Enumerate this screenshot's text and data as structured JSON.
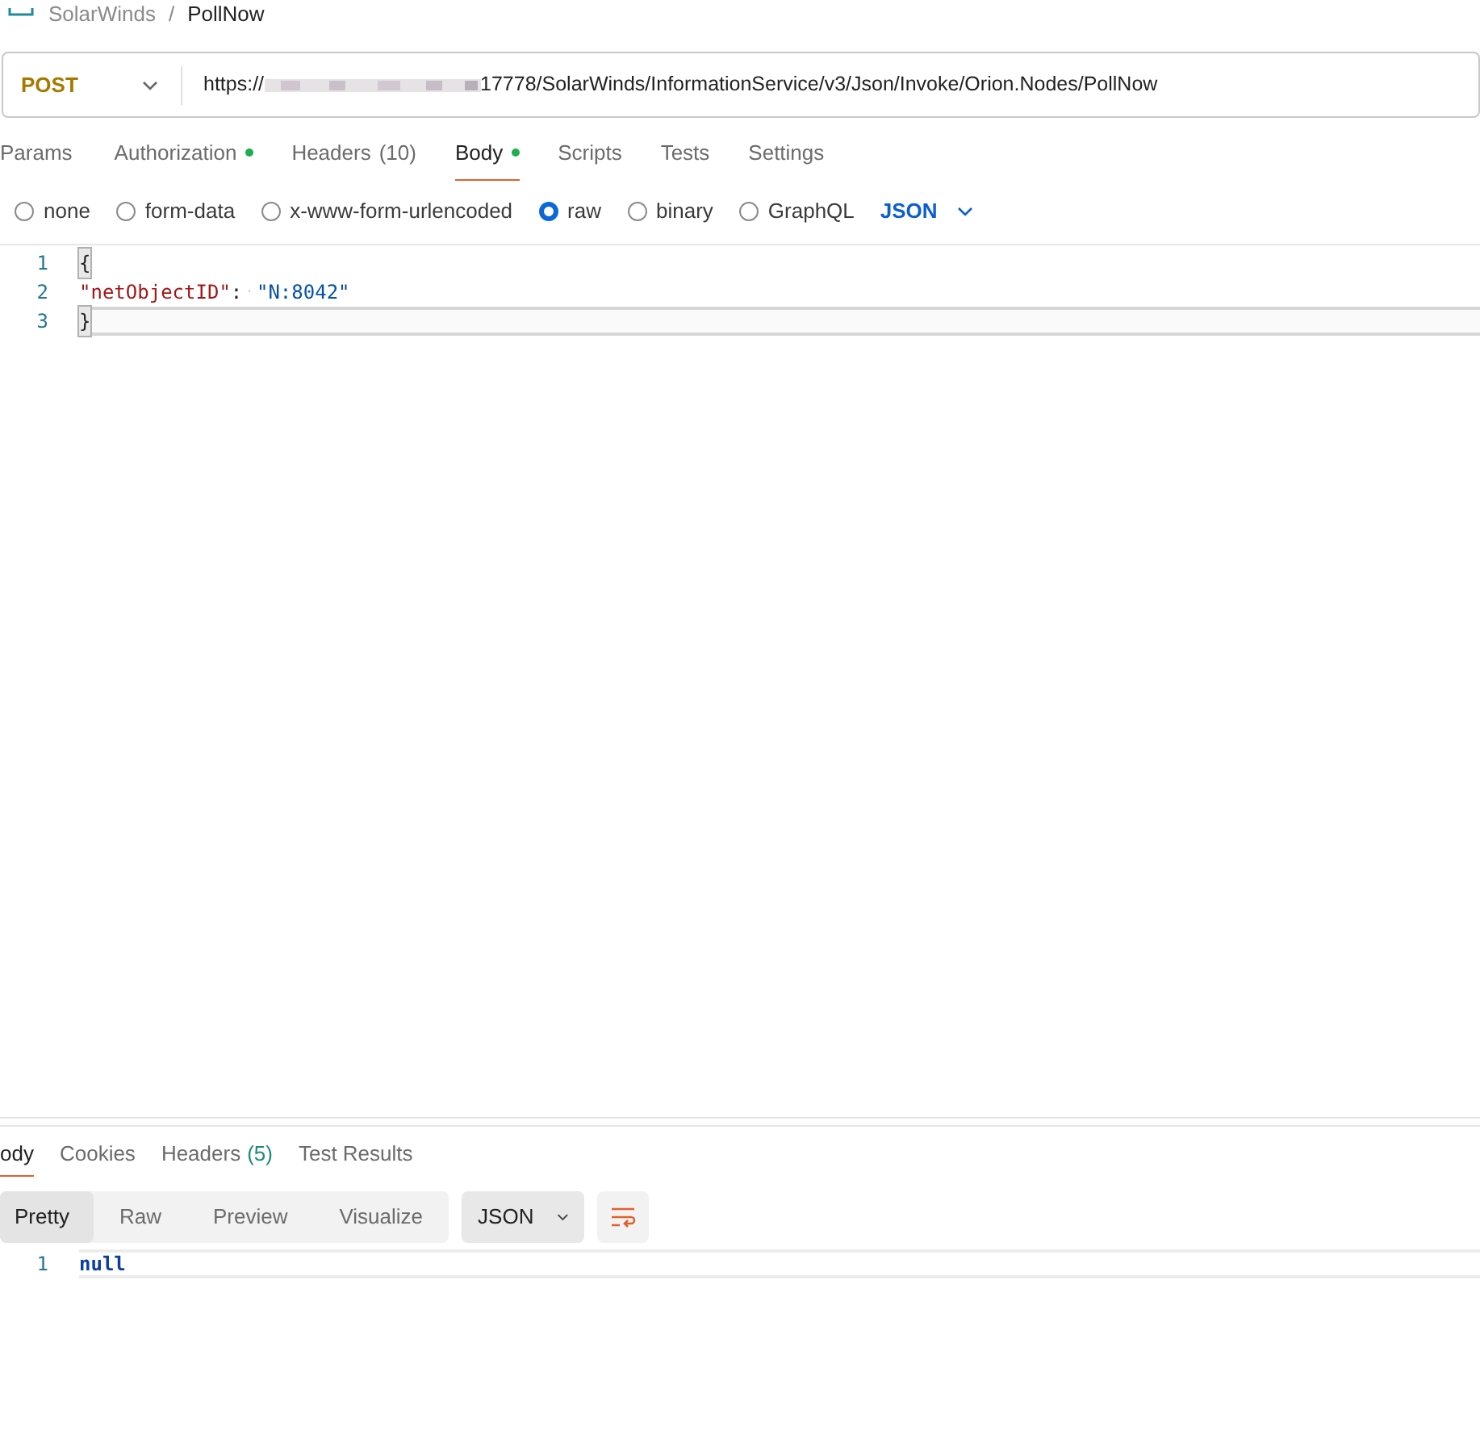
{
  "breadcrumb": {
    "collection": "SolarWinds",
    "separator": "/",
    "request": "PollNow"
  },
  "request": {
    "method": "POST",
    "url_prefix": "https://",
    "url_rest": "17778/SolarWinds/InformationService/v3/Json/Invoke/Orion.Nodes/PollNow"
  },
  "tabs": [
    {
      "label": "Params",
      "selected": false,
      "dot": false
    },
    {
      "label": "Authorization",
      "selected": false,
      "dot": true
    },
    {
      "label": "Headers",
      "count": "(10)",
      "selected": false,
      "dot": false
    },
    {
      "label": "Body",
      "selected": true,
      "dot": true
    },
    {
      "label": "Scripts",
      "selected": false,
      "dot": false
    },
    {
      "label": "Tests",
      "selected": false,
      "dot": false
    },
    {
      "label": "Settings",
      "selected": false,
      "dot": false
    }
  ],
  "body_types": [
    {
      "label": "none",
      "selected": false
    },
    {
      "label": "form-data",
      "selected": false
    },
    {
      "label": "x-www-form-urlencoded",
      "selected": false
    },
    {
      "label": "raw",
      "selected": true
    },
    {
      "label": "binary",
      "selected": false
    },
    {
      "label": "GraphQL",
      "selected": false
    }
  ],
  "raw_format": "JSON",
  "editor": {
    "lines": [
      {
        "number": "1",
        "active": false,
        "tokens": [
          {
            "kind": "brace",
            "text": "{"
          }
        ]
      },
      {
        "number": "2",
        "active": false,
        "tokens": [
          {
            "kind": "key",
            "text": "\"netObjectID\""
          },
          {
            "kind": "punct",
            "text": ":"
          },
          {
            "kind": "space",
            "text": "·"
          },
          {
            "kind": "string",
            "text": "\"N:8042\""
          }
        ]
      },
      {
        "number": "3",
        "active": true,
        "tokens": [
          {
            "kind": "brace",
            "text": "}"
          }
        ]
      }
    ]
  },
  "response": {
    "tabs": [
      {
        "label": "ody",
        "selected": true
      },
      {
        "label": "Cookies",
        "selected": false
      },
      {
        "label": "Headers",
        "count": "(5)",
        "selected": false
      },
      {
        "label": "Test Results",
        "selected": false
      }
    ],
    "views": [
      {
        "label": "Pretty",
        "selected": true
      },
      {
        "label": "Raw",
        "selected": false
      },
      {
        "label": "Preview",
        "selected": false
      },
      {
        "label": "Visualize",
        "selected": false
      }
    ],
    "format": "JSON",
    "lines": [
      {
        "number": "1",
        "text": "null"
      }
    ]
  }
}
